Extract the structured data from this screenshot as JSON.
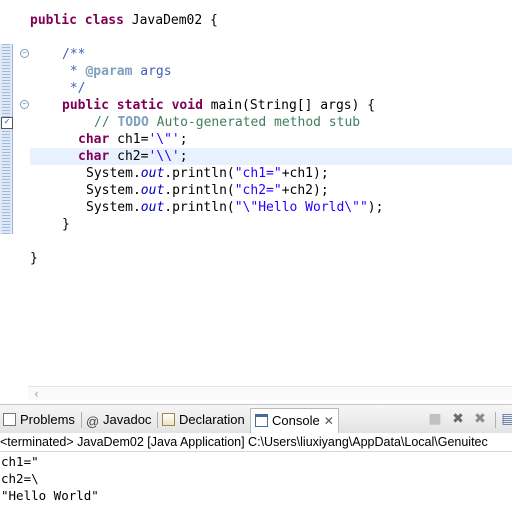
{
  "editor": {
    "lines": {
      "l1": {
        "kw1": "public",
        "kw2": "class",
        "rest": " JavaDem02 {"
      },
      "l2": {
        "text": "/**"
      },
      "l3": {
        "star": " * ",
        "tag": "@param",
        "rest": " args"
      },
      "l4": {
        "text": " */"
      },
      "l5": {
        "kw1": "public",
        "kw2": "static",
        "kw3": "void",
        "rest": " main(String[] args) {"
      },
      "l6": {
        "slashes": "// ",
        "todo": "TODO",
        "rest": " Auto-generated method stub"
      },
      "l7": {
        "kw": "char",
        "mid": " ch1=",
        "str": "'\\\"'",
        "end": ";"
      },
      "l8": {
        "kw": "char",
        "mid": " ch2=",
        "str": "'\\\\'",
        "end": ";"
      },
      "l9": {
        "pre": "System.",
        "fld": "out",
        "mid": ".println(",
        "str": "\"ch1=\"",
        "end": "+ch1);"
      },
      "l10": {
        "pre": "System.",
        "fld": "out",
        "mid": ".println(",
        "str": "\"ch2=\"",
        "end": "+ch2);"
      },
      "l11": {
        "pre": "System.",
        "fld": "out",
        "mid": ".println(",
        "str": "\"\\\"Hello World\\\"\"",
        "end": ");"
      },
      "l12": {
        "text": "}"
      },
      "l13": {
        "text": "}"
      }
    }
  },
  "panel": {
    "tabs": [
      {
        "label": "Problems",
        "icon": "problems-icon"
      },
      {
        "label": "Javadoc",
        "icon": "at-icon"
      },
      {
        "label": "Declaration",
        "icon": "declaration-icon"
      },
      {
        "label": "Console",
        "icon": "console-icon",
        "active": true
      }
    ],
    "toolbar_icons": [
      "terminate-icon",
      "remove-launch-icon",
      "remove-all-icon",
      "display-console-icon"
    ],
    "status": "<terminated> JavaDem02 [Java Application] C:\\Users\\liuxiyang\\AppData\\Local\\Genuitec",
    "output": [
      "ch1=\"",
      "ch2=\\",
      "\"Hello World\""
    ]
  }
}
